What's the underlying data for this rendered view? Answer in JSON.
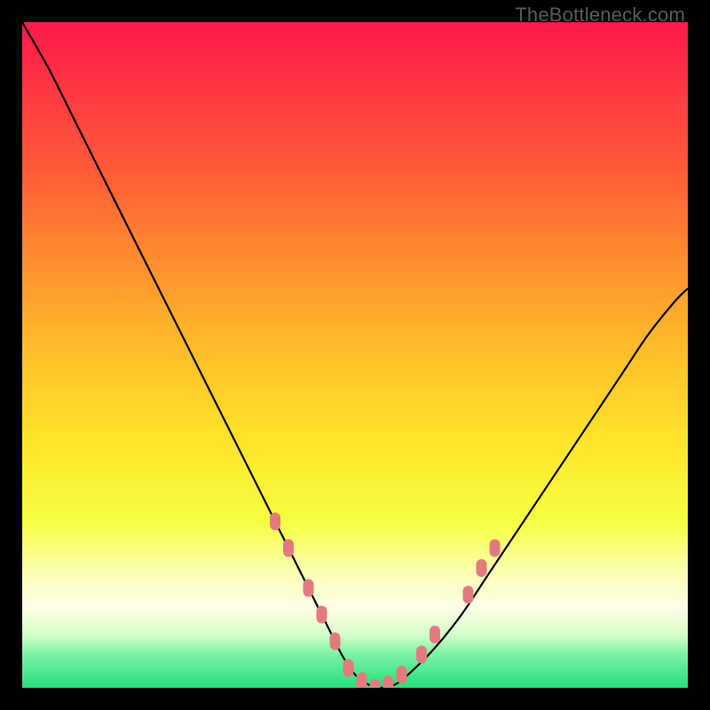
{
  "watermark": "TheBottleneck.com",
  "colors": {
    "top": "#ff1a4b",
    "upper_mid": "#ff7a2a",
    "mid": "#ffd400",
    "lower_mid": "#f7ff3a",
    "pale": "#fdffde",
    "green": "#27e97e",
    "curve": "#000000",
    "marker": "#e37b7e",
    "frame": "#000000"
  },
  "chart_data": {
    "type": "line",
    "title": "",
    "xlabel": "",
    "ylabel": "",
    "xlim": [
      0,
      100
    ],
    "ylim": [
      0,
      100
    ],
    "x": [
      0,
      4,
      8,
      12,
      16,
      20,
      24,
      28,
      32,
      36,
      40,
      44,
      46,
      48,
      50,
      52,
      54,
      56,
      58,
      62,
      66,
      70,
      74,
      78,
      82,
      86,
      90,
      94,
      98,
      100
    ],
    "y": [
      100,
      93,
      85,
      77,
      69,
      61,
      53,
      45,
      37,
      29,
      21,
      13,
      9,
      5,
      2,
      0.5,
      0,
      0.5,
      2,
      6,
      11,
      17,
      23,
      29,
      35,
      41,
      47,
      53,
      58,
      60
    ],
    "markers_x": [
      38,
      40,
      43,
      45,
      47,
      49,
      51,
      53,
      55,
      57,
      60,
      62,
      67,
      69,
      71
    ],
    "markers_y": [
      25,
      21,
      15,
      11,
      7,
      3,
      1,
      0,
      0.5,
      2,
      5,
      8,
      14,
      18,
      21
    ],
    "annotations": []
  }
}
